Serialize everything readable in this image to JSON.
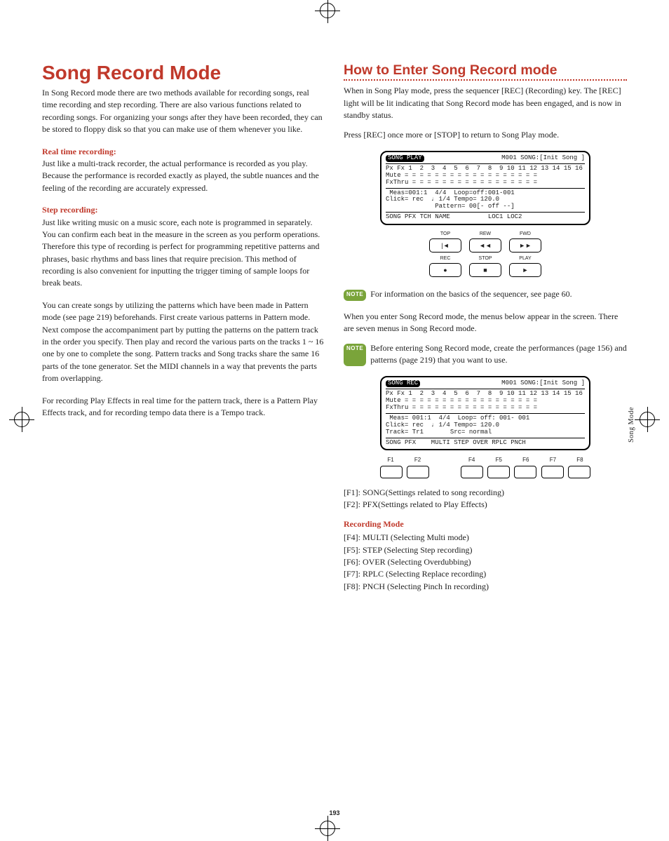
{
  "side_tab": "Song Mode",
  "page_number": "193",
  "left": {
    "title": "Song Record Mode",
    "intro": "In Song Record mode there are two methods available for recording songs, real time recording and step recording. There are also various functions related to recording songs. For organizing your songs after they have been recorded, they can be stored to floppy disk so that you can make use of them whenever you like.",
    "h1": "Real time recording:",
    "p1": "Just like a multi-track recorder, the actual performance is recorded as you play. Because the performance is recorded exactly as played, the subtle nuances and the feeling of the recording are accurately expressed.",
    "h2": "Step recording:",
    "p2": "Just like writing music on a music score, each note is programmed in separately. You can confirm each beat in the measure in the screen as you perform operations. Therefore this type of recording is perfect for programming repetitive patterns and phrases, basic rhythms and bass lines that require precision. This method of recording is also convenient for inputting the trigger timing of sample loops for break beats.",
    "p3": "You can create songs by utilizing the patterns which have been made in Pattern mode (see page 219) beforehands. First create various patterns in Pattern mode. Next compose the accompaniment part by putting the patterns on the pattern track in the order you specify. Then play and record the various parts on the tracks 1 ~ 16 one by one to complete the song. Pattern tracks and Song tracks share the same 16 parts of the tone generator. Set the MIDI channels in a way that prevents the parts from overlapping.",
    "p4": "For recording Play Effects in real time for the pattern track, there is a Pattern Play Effects track, and for recording tempo data there is a Tempo track."
  },
  "right": {
    "title": "How to Enter Song Record mode",
    "p1": "When in Song Play mode, press the sequencer [REC] (Recording) key. The [REC] light will be lit indicating that Song Record mode has been engaged, and is now in standby status.",
    "p2": "Press [REC] once more or [STOP] to return to Song Play mode.",
    "lcd1": {
      "tag": "SONG PLAY",
      "right": "M001 SONG:[Init Song ]",
      "line_nums": "Px Fx 1  2  3  4  5  6  7  8  9 10 11 12 13 14 15 16",
      "mute": "Mute = = = = = = = = = = = = = = = = = =",
      "fx": "FxThru = = = = = = = = = = = = = = = = =",
      "meas": " Meas=001:1  4/4  Loop=off:001-001",
      "click": "Click= rec  ♩ 1/4 Tempo= 120.0",
      "patt": "             Pattern= 00[- off --]",
      "bottom": "SONG PFX TCH NAME          LOC1 LOC2"
    },
    "transport": {
      "top": "TOP",
      "rew": "REW",
      "fwd": "FWD",
      "rec": "REC",
      "stop": "STOP",
      "play": "PLAY",
      "sym_top": "|◄",
      "sym_rew": "◄◄",
      "sym_fwd": "►►",
      "sym_rec": "●",
      "sym_stop": "■",
      "sym_play": "►"
    },
    "note1": "For information on the basics of the sequencer, see page 60.",
    "p3": "When you enter Song Record mode, the menus below appear in the screen. There are seven menus in Song Record mode.",
    "note2": "Before entering Song Record mode, create the performances (page 156) and patterns (page 219) that you want to use.",
    "lcd2": {
      "tag": "SONG REC",
      "right": "M001 SONG:[Init Song ]",
      "line_nums": "Px Fx 1  2  3  4  5  6  7  8  9 10 11 12 13 14 15 16",
      "mute": "Mute = = = = = = = = = = = = = = = = = =",
      "fx": "FxThru = = = = = = = = = = = = = = = = =",
      "meas": " Meas= 001:1  4/4  Loop= off: 001- 001",
      "click": "Click= rec  ♩ 1/4 Tempo= 120.0",
      "track": "Track= Tr1       Src= normal",
      "bottom": "SONG PFX    MULTI STEP OVER RPLC PNCH"
    },
    "fkeys": {
      "f1": "F1",
      "f2": "F2",
      "f3": "",
      "f4": "F4",
      "f5": "F5",
      "f6": "F6",
      "f7": "F7",
      "f8": "F8"
    },
    "flist1": [
      "[F1]: SONG(Settings related to song recording)",
      "[F2]: PFX(Settings related to Play Effects)"
    ],
    "subsub": "Recording Mode",
    "flist2": [
      "[F4]: MULTI (Selecting Multi mode)",
      "[F5]: STEP (Selecting Step recording)",
      "[F6]: OVER (Selecting Overdubbing)",
      "[F7]: RPLC (Selecting Replace recording)",
      "[F8]: PNCH (Selecting Pinch In recording)"
    ]
  }
}
